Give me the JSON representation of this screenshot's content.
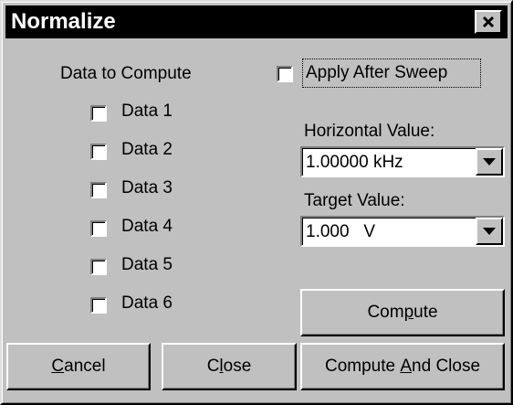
{
  "window": {
    "title": "Normalize",
    "close_icon": "close-icon"
  },
  "data_group": {
    "heading": "Data to Compute",
    "items": [
      {
        "label": "Data 1",
        "checked": false
      },
      {
        "label": "Data 2",
        "checked": false
      },
      {
        "label": "Data 3",
        "checked": false
      },
      {
        "label": "Data 4",
        "checked": false
      },
      {
        "label": "Data 5",
        "checked": false
      },
      {
        "label": "Data 6",
        "checked": false
      }
    ]
  },
  "apply_after_sweep": {
    "label": "Apply After Sweep",
    "checked": false
  },
  "horizontal": {
    "label": "Horizontal Value:",
    "value": "1.00000 kHz"
  },
  "target": {
    "label": "Target Value:",
    "value": "1.000   V"
  },
  "buttons": {
    "compute": {
      "before": "Com",
      "mnemonic": "p",
      "after": "ute"
    },
    "cancel": {
      "before": "",
      "mnemonic": "C",
      "after": "ancel"
    },
    "close": {
      "before": "C",
      "mnemonic": "l",
      "after": "ose"
    },
    "compute_and_close": {
      "before": "Compute ",
      "mnemonic": "A",
      "after": "nd Close"
    }
  },
  "colors": {
    "face": "#c0c0c0",
    "titlebar": "#000000",
    "title_text": "#ffffff"
  }
}
